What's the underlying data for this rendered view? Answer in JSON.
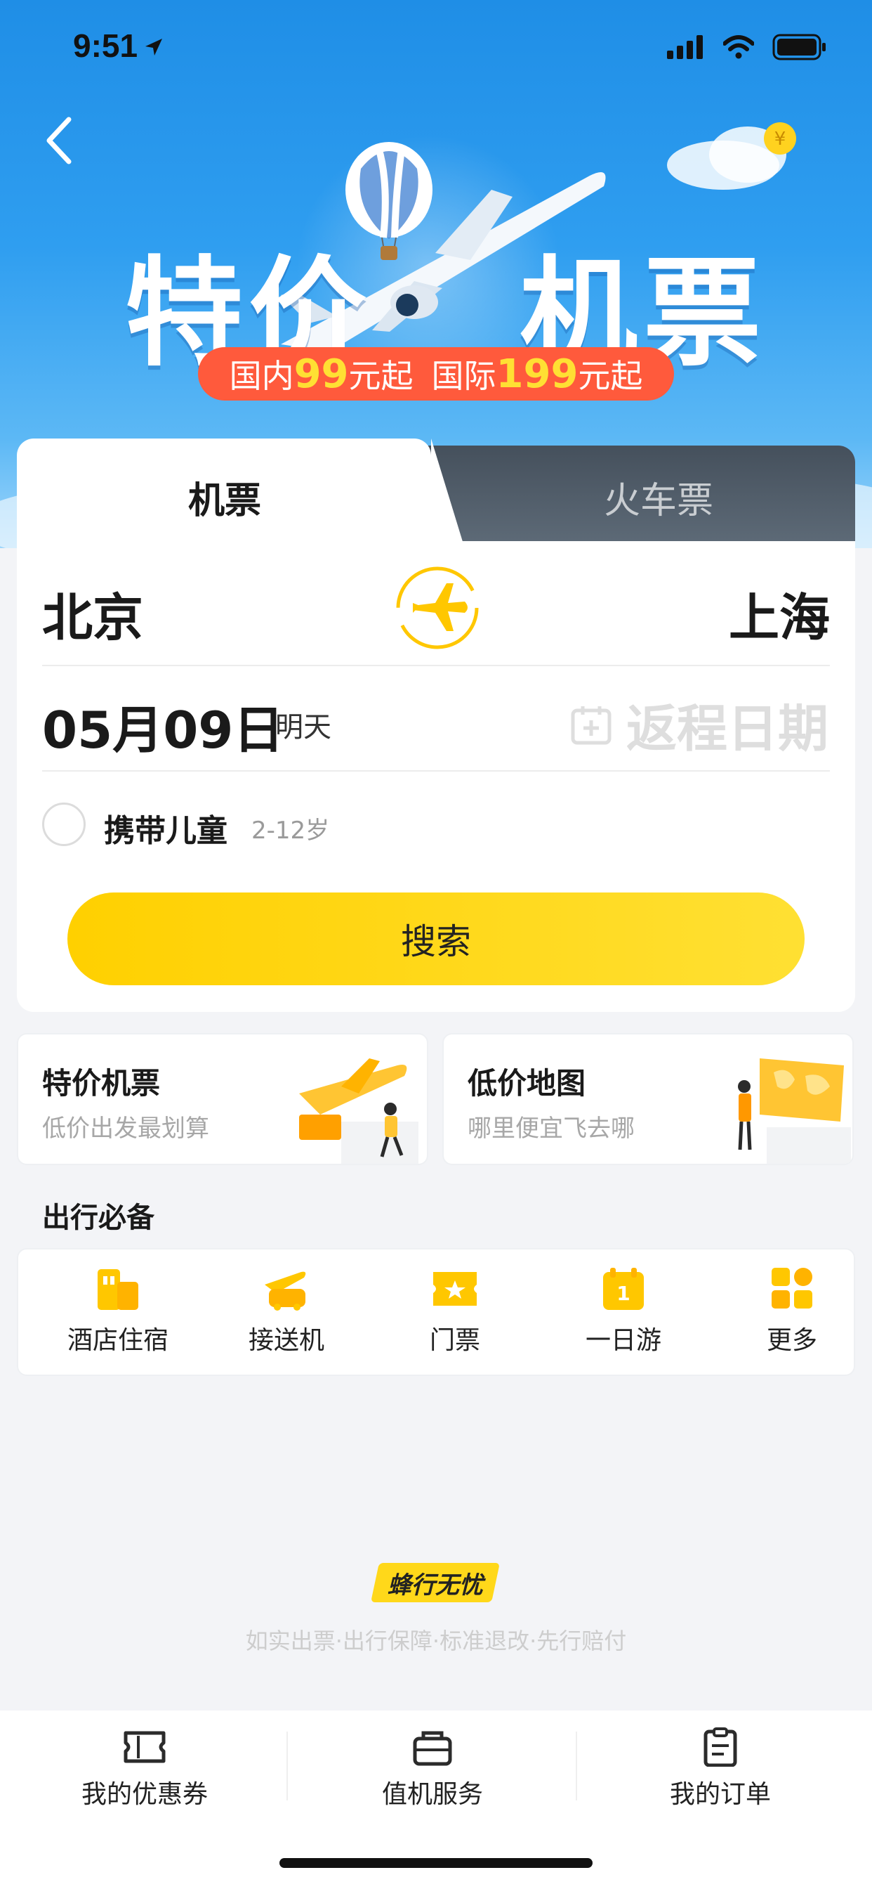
{
  "status_bar": {
    "time": "9:51"
  },
  "hero": {
    "title_left": "特价",
    "title_right": "机票",
    "domestic_prefix": "国内",
    "domestic_price": "99",
    "domestic_suffix": "元起",
    "intl_prefix": "国际",
    "intl_price": "199",
    "intl_suffix": "元起"
  },
  "tabs": {
    "flight": "机票",
    "train": "火车票"
  },
  "booking": {
    "from_city": "北京",
    "to_city": "上海",
    "date": "05月09日",
    "date_tag": "明天",
    "return_placeholder": "返程日期",
    "child_label": "携带儿童",
    "child_age": "2-12岁",
    "search_label": "搜索"
  },
  "promos": [
    {
      "title": "特价机票",
      "subtitle": "低价出发最划算"
    },
    {
      "title": "低价地图",
      "subtitle": "哪里便宜飞去哪"
    }
  ],
  "travel_essentials": {
    "title": "出行必备",
    "items": [
      {
        "label": "酒店住宿",
        "icon": "hotel-icon"
      },
      {
        "label": "接送机",
        "icon": "airport-transfer-icon"
      },
      {
        "label": "门票",
        "icon": "ticket-icon"
      },
      {
        "label": "一日游",
        "icon": "day-tour-icon"
      },
      {
        "label": "更多",
        "icon": "more-grid-icon"
      }
    ]
  },
  "guarantee": {
    "badge": "蜂行无忧",
    "text": "如实出票·出行保障·标准退改·先行赔付"
  },
  "bottom_nav": [
    {
      "label": "我的优惠券",
      "icon": "coupon-icon"
    },
    {
      "label": "值机服务",
      "icon": "check-in-icon"
    },
    {
      "label": "我的订单",
      "icon": "order-icon"
    }
  ],
  "colors": {
    "accent": "#ffd000",
    "brand_blue": "#2f9ef0",
    "promo_red": "#ff5a3c",
    "icon_yellow": "#ffc700"
  }
}
